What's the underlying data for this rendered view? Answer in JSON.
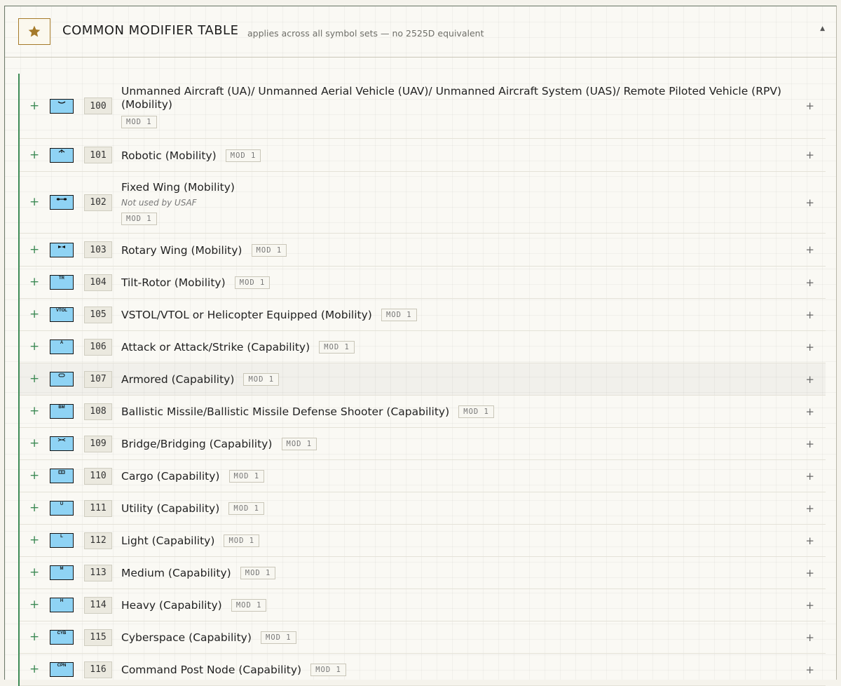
{
  "header": {
    "title": "COMMON MODIFIER TABLE",
    "subtitle": "applies across all symbol sets — no 2525D equivalent",
    "collapse_glyph": "▲",
    "icon": "star-icon",
    "accent": "#a57a2a"
  },
  "colors": {
    "green": "#3d8a55",
    "symbol_fill": "#8fd3f4"
  },
  "rows": [
    {
      "code": "100",
      "name": "Unmanned Aircraft (UA)/ Unmanned Aerial Vehicle (UAV)/ Unmanned Aircraft System (UAS)/ Remote Piloted Vehicle (RPV) (Mobility)",
      "mod": "MOD 1",
      "note": "",
      "glyph": "",
      "symbol": "chevron",
      "plus": "+",
      "expand": "+"
    },
    {
      "code": "101",
      "name": "Robotic (Mobility)",
      "mod": "MOD 1",
      "note": "",
      "glyph": "",
      "symbol": "robot",
      "plus": "+",
      "expand": "+"
    },
    {
      "code": "102",
      "name": "Fixed Wing (Mobility)",
      "mod": "MOD 1",
      "note": "Not used by USAF",
      "glyph": "",
      "symbol": "fixedwing",
      "plus": "+",
      "expand": "+"
    },
    {
      "code": "103",
      "name": "Rotary Wing (Mobility)",
      "mod": "MOD 1",
      "note": "",
      "glyph": "",
      "symbol": "rotary",
      "plus": "+",
      "expand": "+"
    },
    {
      "code": "104",
      "name": "Tilt-Rotor (Mobility)",
      "mod": "MOD 1",
      "note": "",
      "glyph": "TR",
      "symbol": "text",
      "plus": "+",
      "expand": "+"
    },
    {
      "code": "105",
      "name": "VSTOL/VTOL or Helicopter Equipped (Mobility)",
      "mod": "MOD 1",
      "note": "",
      "glyph": "VTOL",
      "symbol": "text",
      "plus": "+",
      "expand": "+"
    },
    {
      "code": "106",
      "name": "Attack or Attack/Strike (Capability)",
      "mod": "MOD 1",
      "note": "",
      "glyph": "A",
      "symbol": "text",
      "plus": "+",
      "expand": "+"
    },
    {
      "code": "107",
      "name": "Armored (Capability)",
      "mod": "MOD 1",
      "note": "",
      "glyph": "",
      "symbol": "armored",
      "plus": "+",
      "expand": "+"
    },
    {
      "code": "108",
      "name": "Ballistic Missile/Ballistic Missile Defense Shooter (Capability)",
      "mod": "MOD 1",
      "note": "",
      "glyph": "BM",
      "symbol": "text",
      "plus": "+",
      "expand": "+"
    },
    {
      "code": "109",
      "name": "Bridge/Bridging (Capability)",
      "mod": "MOD 1",
      "note": "",
      "glyph": "",
      "symbol": "bridge",
      "plus": "+",
      "expand": "+"
    },
    {
      "code": "110",
      "name": "Cargo (Capability)",
      "mod": "MOD 1",
      "note": "",
      "glyph": "",
      "symbol": "cargo",
      "plus": "+",
      "expand": "+"
    },
    {
      "code": "111",
      "name": "Utility (Capability)",
      "mod": "MOD 1",
      "note": "",
      "glyph": "U",
      "symbol": "text",
      "plus": "+",
      "expand": "+"
    },
    {
      "code": "112",
      "name": "Light (Capability)",
      "mod": "MOD 1",
      "note": "",
      "glyph": "L",
      "symbol": "text",
      "plus": "+",
      "expand": "+"
    },
    {
      "code": "113",
      "name": "Medium (Capability)",
      "mod": "MOD 1",
      "note": "",
      "glyph": "M",
      "symbol": "text",
      "plus": "+",
      "expand": "+"
    },
    {
      "code": "114",
      "name": "Heavy (Capability)",
      "mod": "MOD 1",
      "note": "",
      "glyph": "H",
      "symbol": "text",
      "plus": "+",
      "expand": "+"
    },
    {
      "code": "115",
      "name": "Cyberspace (Capability)",
      "mod": "MOD 1",
      "note": "",
      "glyph": "CYB",
      "symbol": "text",
      "plus": "+",
      "expand": "+"
    },
    {
      "code": "116",
      "name": "Command Post Node (Capability)",
      "mod": "MOD 1",
      "note": "",
      "glyph": "CPN",
      "symbol": "text",
      "plus": "+",
      "expand": "+"
    }
  ]
}
